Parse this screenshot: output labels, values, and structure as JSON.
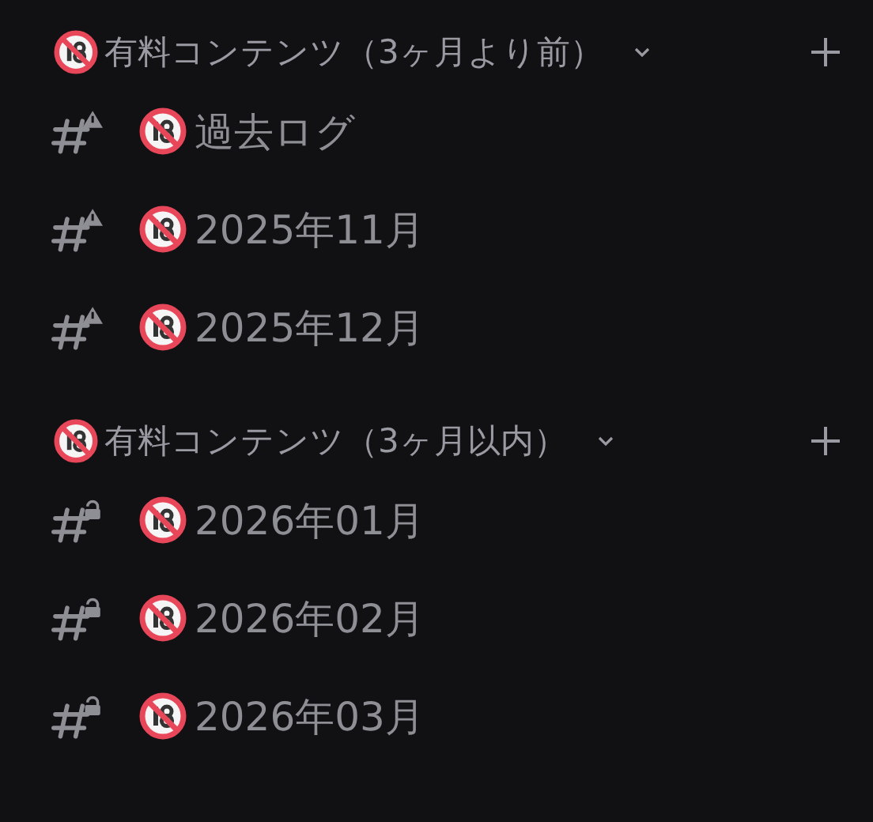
{
  "categories": [
    {
      "name": "有料コンテンツ（3ヶ月より前）",
      "expanded": true,
      "channels": [
        {
          "name": "過去ログ",
          "kind": "warning"
        },
        {
          "name": "2025年11月",
          "kind": "warning"
        },
        {
          "name": "2025年12月",
          "kind": "warning"
        }
      ]
    },
    {
      "name": "有料コンテンツ（3ヶ月以内）",
      "expanded": true,
      "channels": [
        {
          "name": "2026年01月",
          "kind": "locked"
        },
        {
          "name": "2026年02月",
          "kind": "locked"
        },
        {
          "name": "2026年03月",
          "kind": "locked"
        }
      ]
    }
  ]
}
